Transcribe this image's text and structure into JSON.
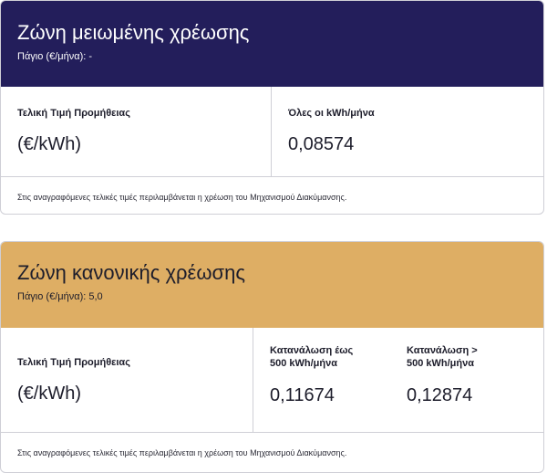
{
  "zones": {
    "reduced": {
      "title": "Ζώνη μειωμένης χρέωσης",
      "fee": "Πάγιο (€/μήνα): -",
      "price_label": "Τελική Τιμή Προμήθειας",
      "unit": "(€/kWh)",
      "columns": [
        {
          "header": "Όλες οι kWh/μήνα",
          "value": "0,08574"
        }
      ],
      "note": "Στις αναγραφόμενες τελικές τιμές περιλαμβάνεται η χρέωση του Μηχανισμού Διακύμανσης."
    },
    "normal": {
      "title": "Ζώνη κανονικής χρέωσης",
      "fee": "Πάγιο (€/μήνα): 5,0",
      "price_label": "Τελική Τιμή Προμήθειας",
      "unit": "(€/kWh)",
      "columns": [
        {
          "header_line1": "Κατανάλωση έως",
          "header_line2": "500 kWh/μήνα",
          "value": "0,11674"
        },
        {
          "header_line1": "Κατανάλωση >",
          "header_line2": "500 kWh/μήνα",
          "value": "0,12874"
        }
      ],
      "note": "Στις αναγραφόμενες τελικές τιμές περιλαμβάνεται η χρέωση του Μηχανισμού Διακύμανσης."
    }
  },
  "colors": {
    "reduced_header_bg": "#231e5b",
    "normal_header_bg": "#deae64",
    "border": "#cfcfd6"
  }
}
